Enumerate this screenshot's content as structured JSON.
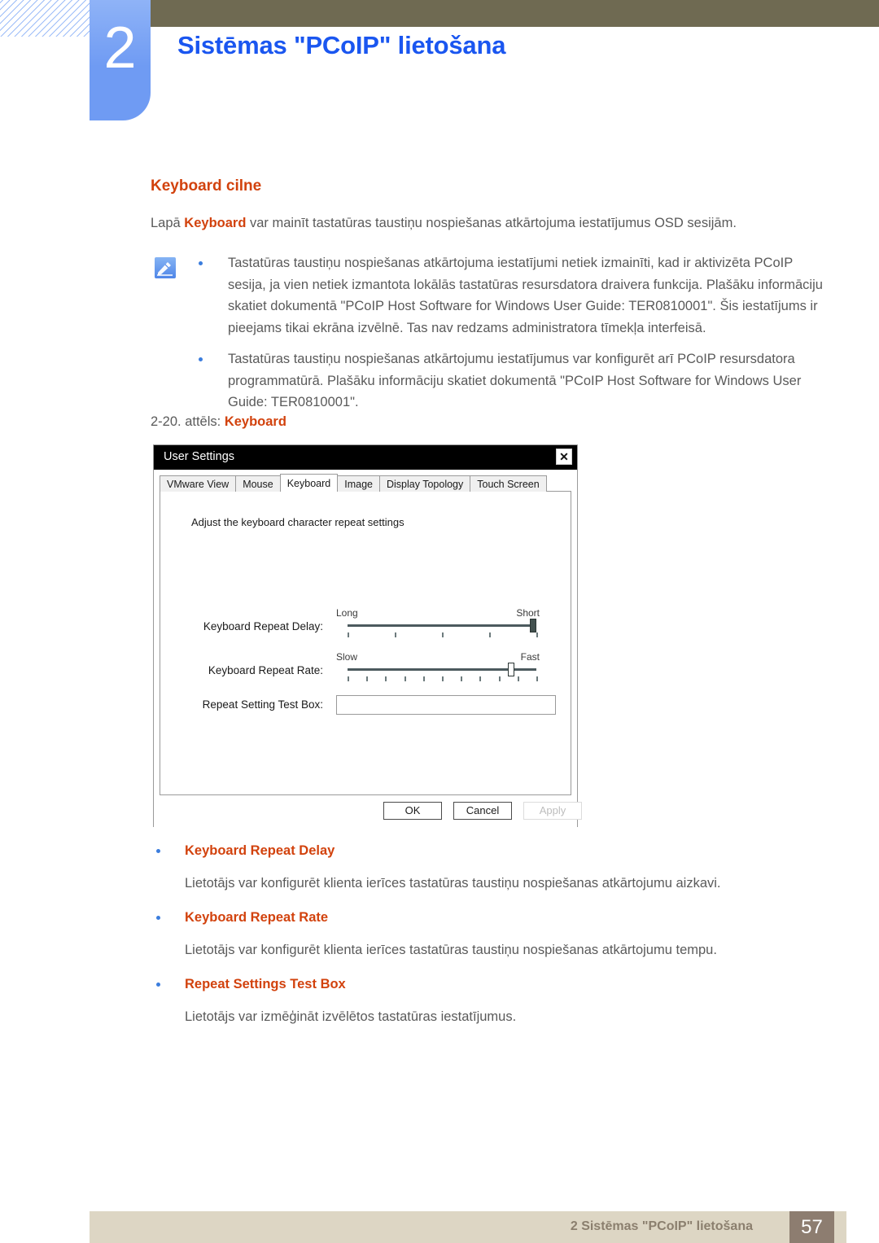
{
  "chapter": {
    "number": "2",
    "title": "Sistēmas \"PCoIP\" lietošana"
  },
  "section": {
    "heading": "Keyboard cilne",
    "intro_prefix": "Lapā ",
    "intro_keyword": "Keyboard",
    "intro_suffix": " var mainīt tastatūras taustiņu nospiešanas atkārtojuma iestatījumus OSD sesijām."
  },
  "note": {
    "icon": "note-pencil-icon",
    "bullets": [
      "Tastatūras taustiņu nospiešanas atkārtojuma iestatījumi netiek izmainīti, kad ir aktivizēta PCoIP sesija, ja vien netiek izmantota lokālās tastatūras resursdatora draivera funkcija. Plašāku informāciju skatiet dokumentā \"PCoIP Host Software for Windows User Guide: TER0810001\". Šis iestatījums ir pieejams tikai ekrāna izvēlnē. Tas nav redzams administratora tīmekļa interfeisā.",
      "Tastatūras taustiņu nospiešanas atkārtojumu iestatījumus var konfigurēt arī PCoIP resursdatora programmatūrā. Plašāku informāciju skatiet dokumentā \"PCoIP Host Software for Windows User Guide: TER0810001\"."
    ]
  },
  "figure": {
    "caption_prefix": "2-20. attēls: ",
    "caption_keyword": "Keyboard"
  },
  "dialog": {
    "title": "User Settings",
    "close_label": "✕",
    "tabs": [
      {
        "label": "VMware View",
        "active": false
      },
      {
        "label": "Mouse",
        "active": false
      },
      {
        "label": "Keyboard",
        "active": true
      },
      {
        "label": "Image",
        "active": false
      },
      {
        "label": "Display Topology",
        "active": false
      },
      {
        "label": "Touch Screen",
        "active": false
      }
    ],
    "panel_hint": "Adjust the keyboard character repeat settings",
    "fields": {
      "repeat_delay": {
        "label": "Keyboard Repeat Delay:",
        "left_cap": "Long",
        "right_cap": "Short",
        "ticks": 5,
        "thumb_percent": 100
      },
      "repeat_rate": {
        "label": "Keyboard Repeat Rate:",
        "left_cap": "Slow",
        "right_cap": "Fast",
        "ticks": 11,
        "thumb_percent": 88
      },
      "test_box": {
        "label": "Repeat Setting Test Box:",
        "value": "",
        "placeholder": ""
      }
    },
    "buttons": {
      "ok": "OK",
      "cancel": "Cancel",
      "apply": "Apply"
    }
  },
  "terms": [
    {
      "title": "Keyboard Repeat Delay",
      "description": "Lietotājs var konfigurēt klienta ierīces tastatūras taustiņu nospiešanas atkārtojumu aizkavi."
    },
    {
      "title": "Keyboard Repeat Rate",
      "description": "Lietotājs var konfigurēt klienta ierīces tastatūras taustiņu nospiešanas atkārtojumu tempu."
    },
    {
      "title": "Repeat Settings Test Box",
      "description": "Lietotājs var izmēģināt izvēlētos tastatūras iestatījumus."
    }
  ],
  "footer": {
    "text": "2 Sistēmas \"PCoIP\" lietošana",
    "page": "57"
  },
  "colors": {
    "accent_orange": "#d2420d",
    "title_blue": "#1a56f0",
    "badge_blue": "#6f9bf3",
    "olive": "#6f6a52",
    "footer_beige": "#ddd6c4",
    "footer_brown": "#8d7d70"
  }
}
